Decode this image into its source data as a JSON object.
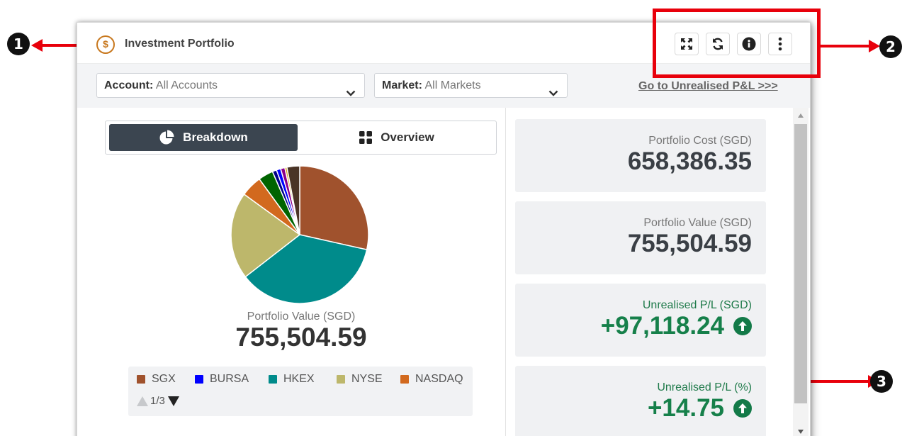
{
  "callouts": [
    "1",
    "2",
    "3"
  ],
  "widget": {
    "title": "Investment Portfolio",
    "title_icon_glyph": "$",
    "title_icon": "dollar-coin-icon",
    "toolbar": [
      {
        "name": "expand-button",
        "icon": "expand-icon"
      },
      {
        "name": "refresh-button",
        "icon": "refresh-icon"
      },
      {
        "name": "info-button",
        "icon": "info-icon"
      },
      {
        "name": "more-button",
        "icon": "more-vertical-icon"
      }
    ]
  },
  "filters": {
    "account": {
      "label": "Account:",
      "value": "All Accounts"
    },
    "market": {
      "label": "Market:",
      "value": "All Markets"
    },
    "link": "Go to Unrealised P&L >>>"
  },
  "toggle": {
    "breakdown": "Breakdown",
    "overview": "Overview",
    "active": "breakdown"
  },
  "chart_data": {
    "type": "pie",
    "slices": [
      {
        "name": "SGX",
        "value": 28.5,
        "color": "#a0522d"
      },
      {
        "name": "HKEX",
        "value": 36.0,
        "color": "#008b8b"
      },
      {
        "name": "NYSE",
        "value": 20.5,
        "color": "#bdb76b"
      },
      {
        "name": "NASDAQ",
        "value": 5.0,
        "color": "#d2691e"
      },
      {
        "name": "",
        "value": 3.5,
        "color": "#006400"
      },
      {
        "name": "",
        "value": 1.0,
        "color": "#00008b"
      },
      {
        "name": "BURSA",
        "value": 1.0,
        "color": "#0000ff"
      },
      {
        "name": "",
        "value": 1.0,
        "color": "#8b008b"
      },
      {
        "name": "",
        "value": 0.5,
        "color": "#daa520"
      },
      {
        "name": "",
        "value": 3.0,
        "color": "#4a3426"
      }
    ],
    "legend": [
      {
        "name": "SGX",
        "color": "#a0522d"
      },
      {
        "name": "BURSA",
        "color": "#0000ff"
      },
      {
        "name": "HKEX",
        "color": "#008b8b"
      },
      {
        "name": "NYSE",
        "color": "#bdb76b"
      },
      {
        "name": "NASDAQ",
        "color": "#d2691e"
      }
    ],
    "center_label": "Portfolio Value (SGD)",
    "center_value": "755,504.59",
    "legend_page": "1/3"
  },
  "cards": [
    {
      "label": "Portfolio Cost (SGD)",
      "value": "658,386.35",
      "trend": false
    },
    {
      "label": "Portfolio Value (SGD)",
      "value": "755,504.59",
      "trend": false
    },
    {
      "label": "Unrealised P/L (SGD)",
      "value": "+97,118.24",
      "trend": true
    },
    {
      "label": "Unrealised P/L (%)",
      "value": "+14.75",
      "trend": true
    }
  ],
  "colors": {
    "accent_dark": "#3b4550",
    "positive": "#16804a",
    "annotation_red": "#e8000b"
  }
}
